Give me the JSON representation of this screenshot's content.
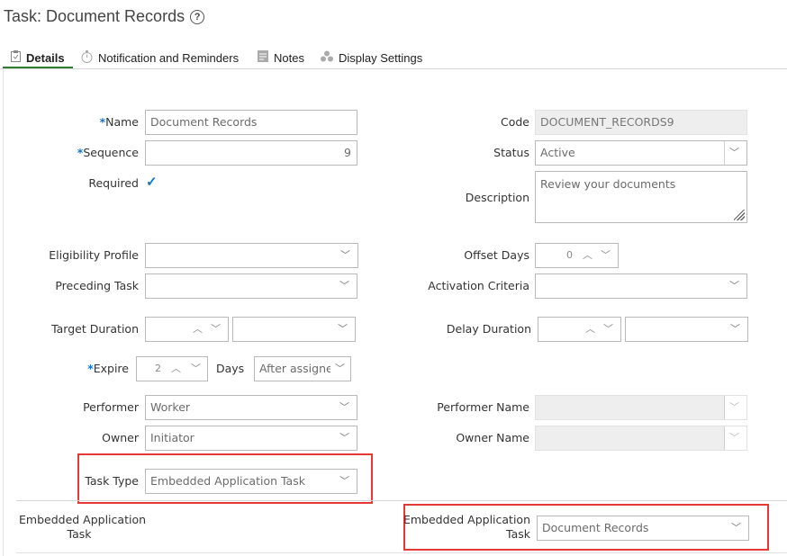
{
  "page": {
    "title": "Task: Document Records"
  },
  "tabs": [
    {
      "label": "Details",
      "icon": "clipboard-icon"
    },
    {
      "label": "Notification and Reminders",
      "icon": "stopwatch-icon"
    },
    {
      "label": "Notes",
      "icon": "note-icon"
    },
    {
      "label": "Display Settings",
      "icon": "dots-icon"
    }
  ],
  "form": {
    "name": {
      "label": "Name",
      "value": "Document Records"
    },
    "sequence": {
      "label": "Sequence",
      "value": "9"
    },
    "required": {
      "label": "Required",
      "checked": true
    },
    "code": {
      "label": "Code",
      "value": "DOCUMENT_RECORDS9"
    },
    "status": {
      "label": "Status",
      "value": "Active"
    },
    "description": {
      "label": "Description",
      "value": "Review your documents"
    },
    "eligibility_profile": {
      "label": "Eligibility Profile",
      "value": ""
    },
    "offset_days": {
      "label": "Offset Days",
      "value": "0"
    },
    "preceding_task": {
      "label": "Preceding Task",
      "value": ""
    },
    "activation_criteria": {
      "label": "Activation Criteria",
      "value": ""
    },
    "target_duration": {
      "label": "Target Duration",
      "value": ""
    },
    "delay_duration": {
      "label": "Delay Duration",
      "value": ""
    },
    "expire": {
      "label": "Expire",
      "value": "2",
      "unit_label": "Days",
      "mode": "After assignee"
    },
    "performer": {
      "label": "Performer",
      "value": "Worker"
    },
    "performer_name": {
      "label": "Performer Name",
      "value": ""
    },
    "owner": {
      "label": "Owner",
      "value": "Initiator"
    },
    "owner_name": {
      "label": "Owner Name",
      "value": ""
    },
    "task_type": {
      "label": "Task Type",
      "value": "Embedded Application Task"
    },
    "embedded_left": {
      "label_line1": "Embedded Application",
      "label_line2": "Task"
    },
    "embedded_right": {
      "label_line1": "Embedded Application",
      "label_line2": "Task",
      "value": "Document Records"
    }
  },
  "glyphs": {
    "required_marker": "*",
    "chevron_down": "﹀",
    "chevron_up": "︿",
    "check": "✓",
    "help": "?"
  },
  "colors": {
    "accent": "#1a73c6",
    "highlight": "#e53935",
    "active_tab": "#2e7d32"
  }
}
